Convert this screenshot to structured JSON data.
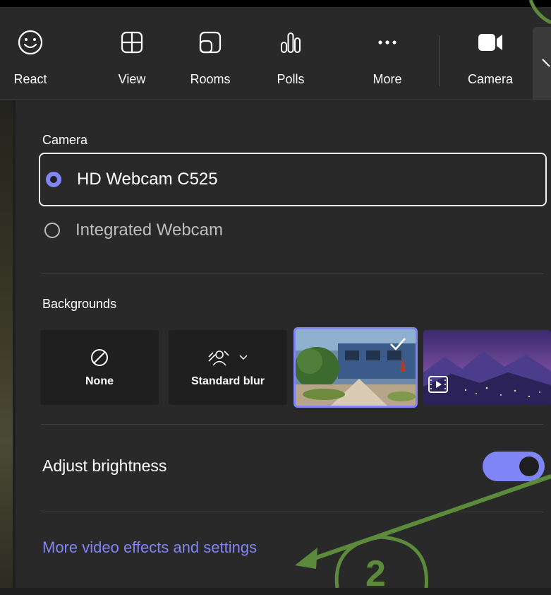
{
  "toolbar": {
    "items": [
      {
        "label": "React",
        "icon": "smiley-icon"
      },
      {
        "label": "View",
        "icon": "grid-icon"
      },
      {
        "label": "Rooms",
        "icon": "rooms-icon"
      },
      {
        "label": "Polls",
        "icon": "polls-icon"
      },
      {
        "label": "More",
        "icon": "more-dots-icon"
      },
      {
        "label": "Camera",
        "icon": "camera-icon"
      }
    ]
  },
  "camera": {
    "heading": "Camera",
    "options": [
      {
        "label": "HD Webcam C525",
        "selected": true
      },
      {
        "label": "Integrated Webcam",
        "selected": false
      }
    ]
  },
  "backgrounds": {
    "heading": "Backgrounds",
    "tiles": [
      {
        "label": "None",
        "icon": "no-symbol-icon"
      },
      {
        "label": "Standard blur",
        "icon": "blur-icon"
      },
      {
        "label": "",
        "icon": "checkmark-icon",
        "selected": true
      },
      {
        "label": "",
        "icon": "video-play-icon"
      }
    ]
  },
  "brightness": {
    "label": "Adjust brightness",
    "enabled": true
  },
  "link": {
    "label": "More video effects and settings"
  },
  "annotation": {
    "label": "2",
    "color": "#5b8a3a"
  },
  "colors": {
    "accent": "#7f85f5",
    "background": "#292929"
  }
}
